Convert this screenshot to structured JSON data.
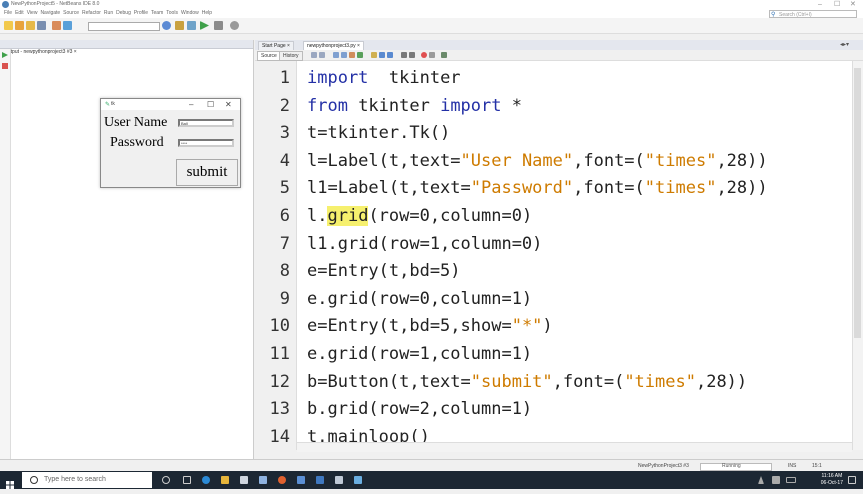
{
  "window": {
    "title": "NewPythonProject5 - NetBeans IDE 8.0",
    "minimize_glyph": "–",
    "maximize_glyph": "☐",
    "close_glyph": "✕"
  },
  "menu": [
    "File",
    "Edit",
    "View",
    "Navigate",
    "Source",
    "Refactor",
    "Run",
    "Debug",
    "Profile",
    "Team",
    "Tools",
    "Window",
    "Help"
  ],
  "search": {
    "placeholder": "Search (Ctrl+I)"
  },
  "output_panel": {
    "tab_label": "Output - newpythonproject3 #3 ×"
  },
  "tk_window": {
    "title": "tk",
    "user_label": "User Name",
    "password_label": "Password",
    "user_value": "Ball",
    "password_value": "****",
    "submit_label": "submit"
  },
  "editor": {
    "tabs": [
      "Start Page ×",
      "newpythonproject3.py ×"
    ],
    "source_tab": "Source",
    "history_tab": "History",
    "lines": [
      {
        "n": "1",
        "parts": [
          [
            "kw",
            "import"
          ],
          [
            "",
            "  tkinter"
          ]
        ]
      },
      {
        "n": "2",
        "parts": [
          [
            "kw",
            "from"
          ],
          [
            "",
            " tkinter "
          ],
          [
            "kw",
            "import"
          ],
          [
            "",
            " *"
          ]
        ]
      },
      {
        "n": "3",
        "parts": [
          [
            "",
            "t=tkinter.Tk()"
          ]
        ]
      },
      {
        "n": "4",
        "parts": [
          [
            "",
            "l=Label(t,text="
          ],
          [
            "str",
            "\"User Name\""
          ],
          [
            "",
            ",font=("
          ],
          [
            "str",
            "\"times\""
          ],
          [
            "",
            ",28))"
          ]
        ]
      },
      {
        "n": "5",
        "parts": [
          [
            "",
            "l1=Label(t,text="
          ],
          [
            "str",
            "\"Password\""
          ],
          [
            "",
            ",font=("
          ],
          [
            "str",
            "\"times\""
          ],
          [
            "",
            ",28))"
          ]
        ]
      },
      {
        "n": "6",
        "parts": [
          [
            "",
            "l."
          ],
          [
            "hl",
            "grid"
          ],
          [
            "",
            "(row=0,column=0)"
          ]
        ]
      },
      {
        "n": "7",
        "parts": [
          [
            "",
            "l1.grid(row=1,column=0)"
          ]
        ]
      },
      {
        "n": "8",
        "parts": [
          [
            "",
            "e=Entry(t,bd=5)"
          ]
        ]
      },
      {
        "n": "9",
        "parts": [
          [
            "",
            "e.grid(row=0,column=1)"
          ]
        ]
      },
      {
        "n": "10",
        "parts": [
          [
            "",
            "e=Entry(t,bd=5,show="
          ],
          [
            "str",
            "\"*\""
          ],
          [
            "",
            ")"
          ]
        ]
      },
      {
        "n": "11",
        "parts": [
          [
            "",
            "e.grid(row=1,column=1)"
          ]
        ]
      },
      {
        "n": "12",
        "parts": [
          [
            "",
            "b=Button(t,text="
          ],
          [
            "str",
            "\"submit\""
          ],
          [
            "",
            ",font=("
          ],
          [
            "str",
            "\"times\""
          ],
          [
            "",
            ",28))"
          ]
        ]
      },
      {
        "n": "13",
        "parts": [
          [
            "",
            "b.grid(row=2,column=1)"
          ]
        ]
      },
      {
        "n": "14",
        "parts": [
          [
            "",
            "t.mainloop()"
          ]
        ]
      }
    ]
  },
  "status": {
    "project": "NewPythonProject3 #3",
    "state": "Running",
    "insert_mode": "INS",
    "position": "15:1"
  },
  "taskbar": {
    "search_placeholder": "Type here to search",
    "time": "11:16 AM",
    "date": "06-Oct-17"
  },
  "colors": {
    "keyword": "#2330a6",
    "string": "#ce7b00",
    "highlight": "#f6f06e",
    "taskbar": "#1c2733"
  }
}
